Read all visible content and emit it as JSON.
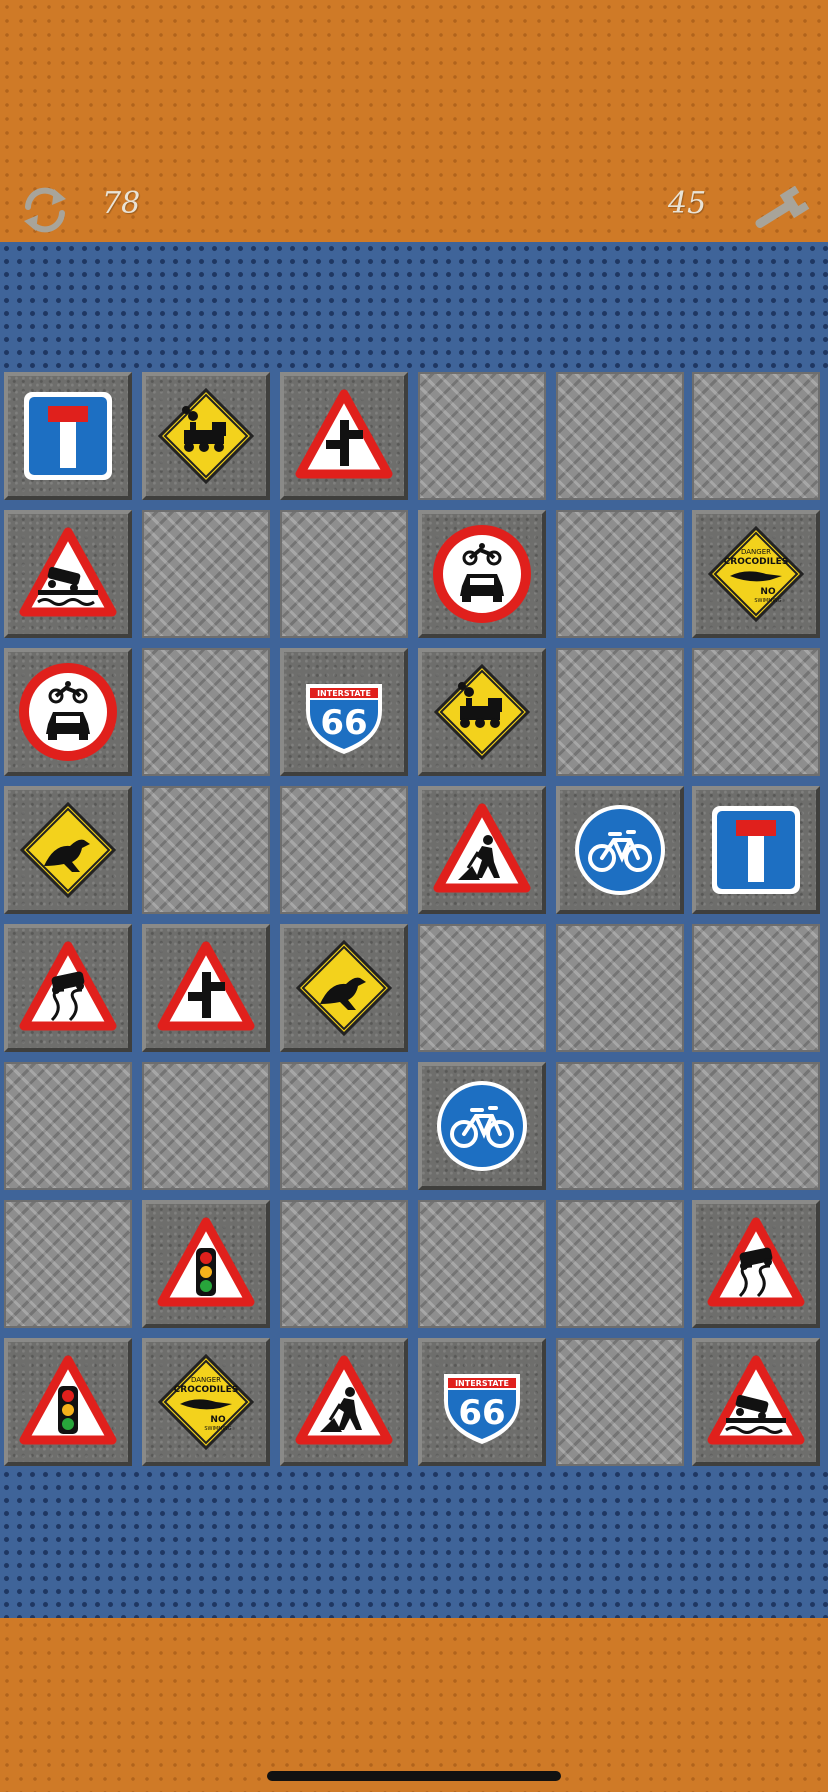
{
  "hud": {
    "moves": "78",
    "pairs": "45",
    "restart_icon": "restart-arrows-icon",
    "settings_icon": "wrench-icon"
  },
  "colors": {
    "orange": "#cf7a27",
    "blue": "#3f6499",
    "hud_text": "#e9e3d6",
    "sign_red": "#e0201c",
    "sign_yellow": "#f3d21c",
    "sign_blue": "#1d6fc2"
  },
  "board": {
    "columns": 6,
    "rows": 8,
    "tiles": [
      [
        "dead-end",
        "steam-train",
        "side-road",
        null,
        null,
        null
      ],
      [
        "quayside",
        null,
        null,
        "no-motor-vehicles",
        null,
        "crocodiles"
      ],
      [
        "no-motor-vehicles",
        null,
        "interstate-66",
        "steam-train",
        null,
        null
      ],
      [
        "kangaroo",
        null,
        null,
        "roadworks",
        "cycle-route",
        "dead-end"
      ],
      [
        "slippery-road",
        "side-road",
        "kangaroo",
        null,
        null,
        null
      ],
      [
        null,
        null,
        null,
        "cycle-route",
        null,
        null
      ],
      [
        null,
        "traffic-signals",
        null,
        null,
        null,
        "slippery-road"
      ],
      [
        "traffic-signals",
        "crocodiles",
        "roadworks",
        "interstate-66",
        null,
        "quayside"
      ]
    ]
  },
  "sign_text": {
    "interstate_word": "INTERSTATE",
    "interstate_number": "66",
    "croc_danger": "DANGER",
    "croc_title": "CROCODILES",
    "croc_no": "NO",
    "croc_swimming": "SWIMMING"
  }
}
